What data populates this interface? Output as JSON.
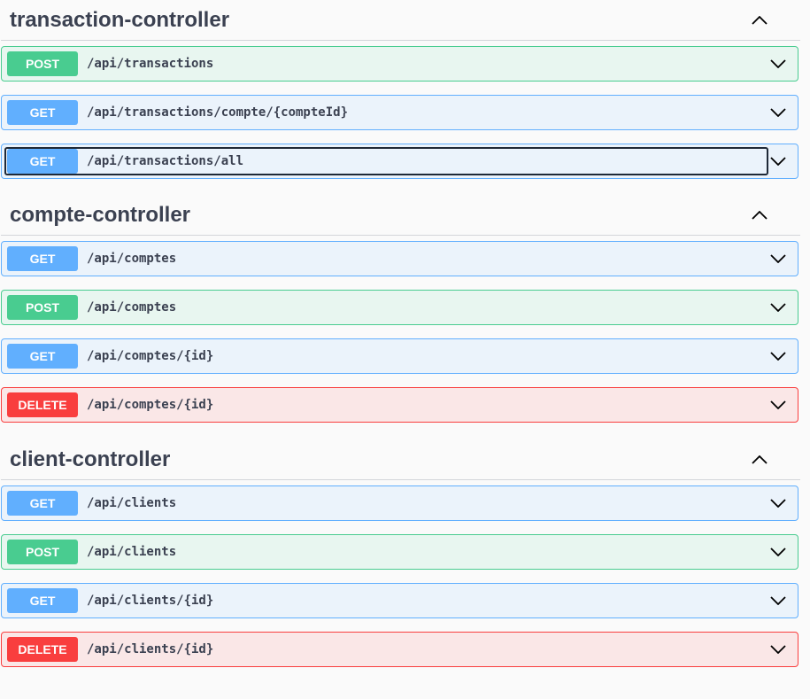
{
  "sections": [
    {
      "title": "transaction-controller",
      "operations": [
        {
          "method": "POST",
          "path": "/api/transactions"
        },
        {
          "method": "GET",
          "path": "/api/transactions/compte/{compteId}"
        },
        {
          "method": "GET",
          "path": "/api/transactions/all"
        }
      ]
    },
    {
      "title": "compte-controller",
      "operations": [
        {
          "method": "GET",
          "path": "/api/comptes"
        },
        {
          "method": "POST",
          "path": "/api/comptes"
        },
        {
          "method": "GET",
          "path": "/api/comptes/{id}"
        },
        {
          "method": "DELETE",
          "path": "/api/comptes/{id}"
        }
      ]
    },
    {
      "title": "client-controller",
      "operations": [
        {
          "method": "GET",
          "path": "/api/clients"
        },
        {
          "method": "POST",
          "path": "/api/clients"
        },
        {
          "method": "GET",
          "path": "/api/clients/{id}"
        },
        {
          "method": "DELETE",
          "path": "/api/clients/{id}"
        }
      ]
    }
  ],
  "colors": {
    "post": "#49cc90",
    "get": "#61affe",
    "delete": "#f93e3e"
  },
  "icons": {
    "collapse": "chevron-up-icon",
    "expand": "chevron-down-icon"
  }
}
